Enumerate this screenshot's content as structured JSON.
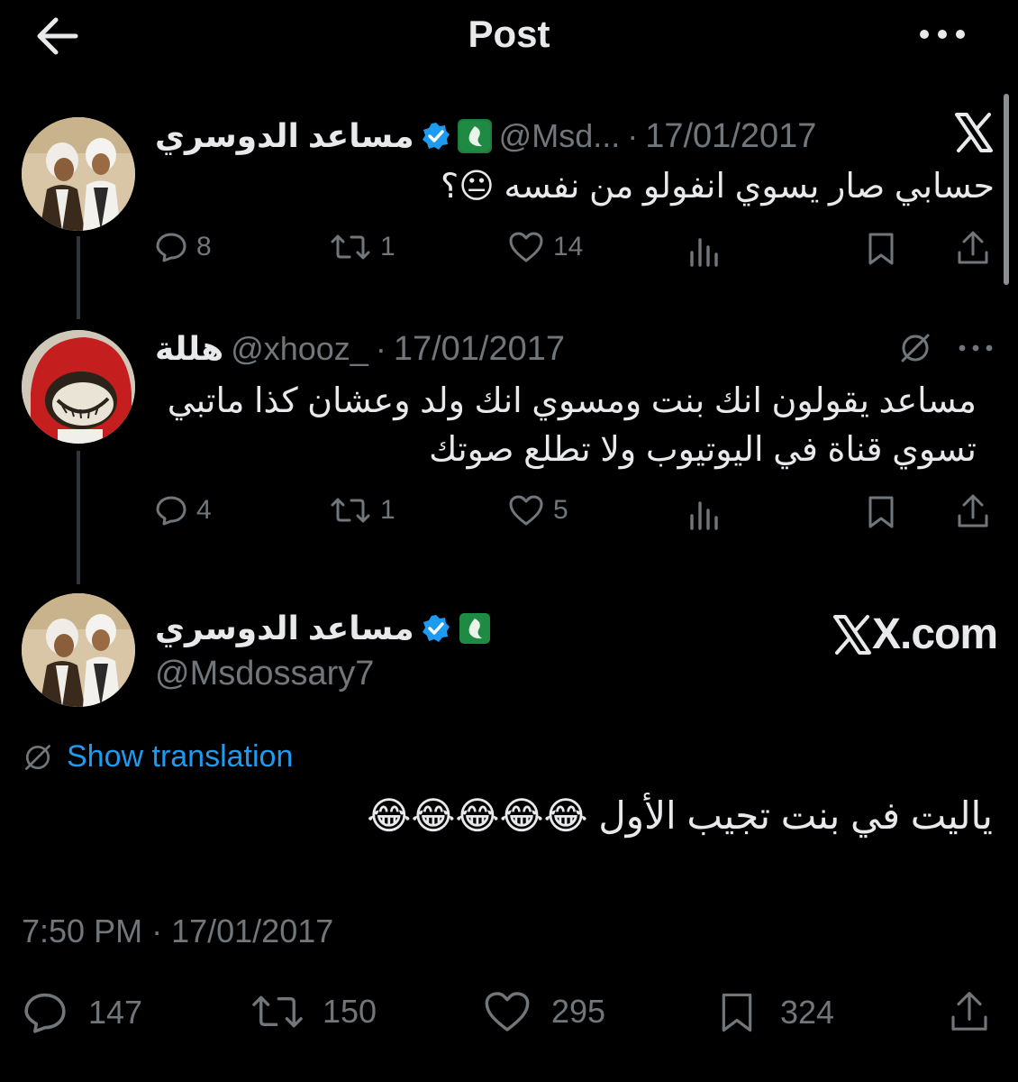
{
  "header": {
    "title": "Post"
  },
  "tweets": [
    {
      "name": "مساعد الدوسري",
      "handle": "@Msd...",
      "dot": "·",
      "date": "17/01/2017",
      "text": "حسابي صار يسوي انفولو من نفسه 😐؟",
      "actions": {
        "replies": "8",
        "reposts": "1",
        "likes": "14"
      }
    },
    {
      "name": "هللة",
      "handle": "@xhooz_",
      "dot": "·",
      "date": "17/01/2017",
      "text_line1": "مساعد يقولون انك بنت ومسوي انك ولد وعشان كذا ماتبي",
      "text_line2": "تسوي قناة في اليوتيوب ولا تطلع صوتك",
      "actions": {
        "replies": "4",
        "reposts": "1",
        "likes": "5"
      }
    }
  ],
  "main_tweet": {
    "name": "مساعد الدوسري",
    "handle": "@Msdossary7",
    "brand": "X.com",
    "translation": "Show translation",
    "text": "ياليت في بنت تجيب الأول 😂😂😂😂😂",
    "time": "7:50 PM",
    "dot": "·",
    "date": "17/01/2017",
    "actions": {
      "replies": "147",
      "reposts": "150",
      "likes": "295",
      "bookmarks": "324"
    }
  },
  "colors": {
    "background": "#000000",
    "text": "#e7e9ea",
    "muted": "#71767b",
    "link": "#1d9bf0",
    "verified": "#1d9bf0"
  },
  "icons": [
    "back-arrow-icon",
    "more-icon",
    "x-logo-icon",
    "verified-icon",
    "reply-icon",
    "repost-icon",
    "like-icon",
    "views-icon",
    "bookmark-icon",
    "share-icon",
    "translate-icon"
  ]
}
